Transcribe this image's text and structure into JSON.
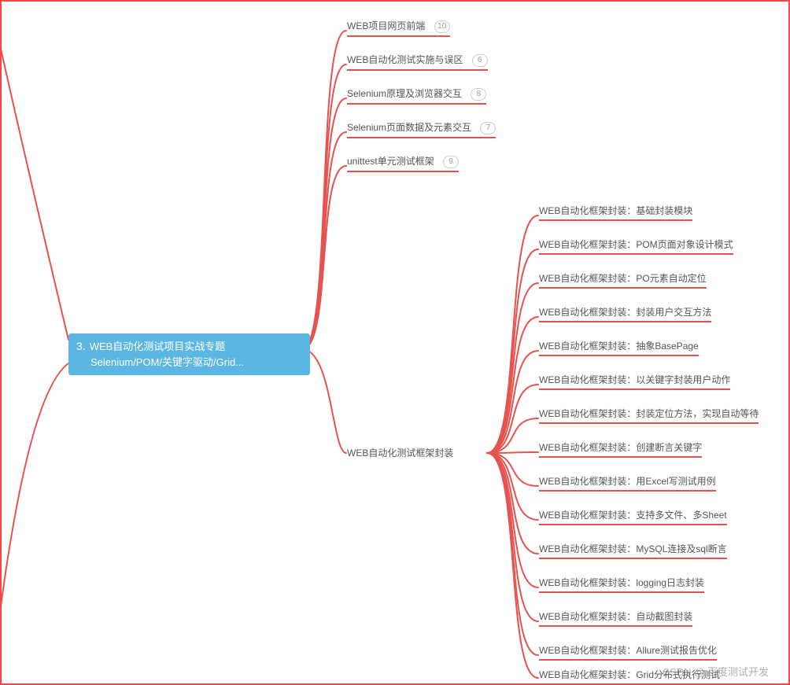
{
  "root": {
    "num": "3.",
    "line1": "WEB自动化测试项目实战专题",
    "line2": "Selenium/POM/关键字驱动/Grid..."
  },
  "top_children": [
    {
      "label": "WEB项目网页前端",
      "badge": "10"
    },
    {
      "label": "WEB自动化测试实施与误区",
      "badge": "6"
    },
    {
      "label": "Selenium原理及浏览器交互",
      "badge": "8"
    },
    {
      "label": "Selenium页面数据及元素交互",
      "badge": "7"
    },
    {
      "label": "unittest单元测试框架",
      "badge": "9"
    }
  ],
  "middle_node": {
    "label": "WEB自动化测试框架封装"
  },
  "sub_children": [
    "WEB自动化框架封装：基础封装模块",
    "WEB自动化框架封装：POM页面对象设计模式",
    "WEB自动化框架封装：PO元素自动定位",
    "WEB自动化框架封装：封装用户交互方法",
    "WEB自动化框架封装：抽象BasePage",
    "WEB自动化框架封装：以关键字封装用户动作",
    "WEB自动化框架封装：封装定位方法，实现自动等待",
    "WEB自动化框架封装：创建断言关键字",
    "WEB自动化框架封装：用Excel写测试用例",
    "WEB自动化框架封装：支持多文件、多Sheet",
    "WEB自动化框架封装：MySQL连接及sql断言",
    "WEB自动化框架封装：logging日志封装",
    "WEB自动化框架封装：自动截图封装",
    "WEB自动化框架封装：Allure测试报告优化",
    "WEB自动化框架封装：Grid分布式执行测试"
  ],
  "watermark": "CSDN @ 百度测试开发"
}
